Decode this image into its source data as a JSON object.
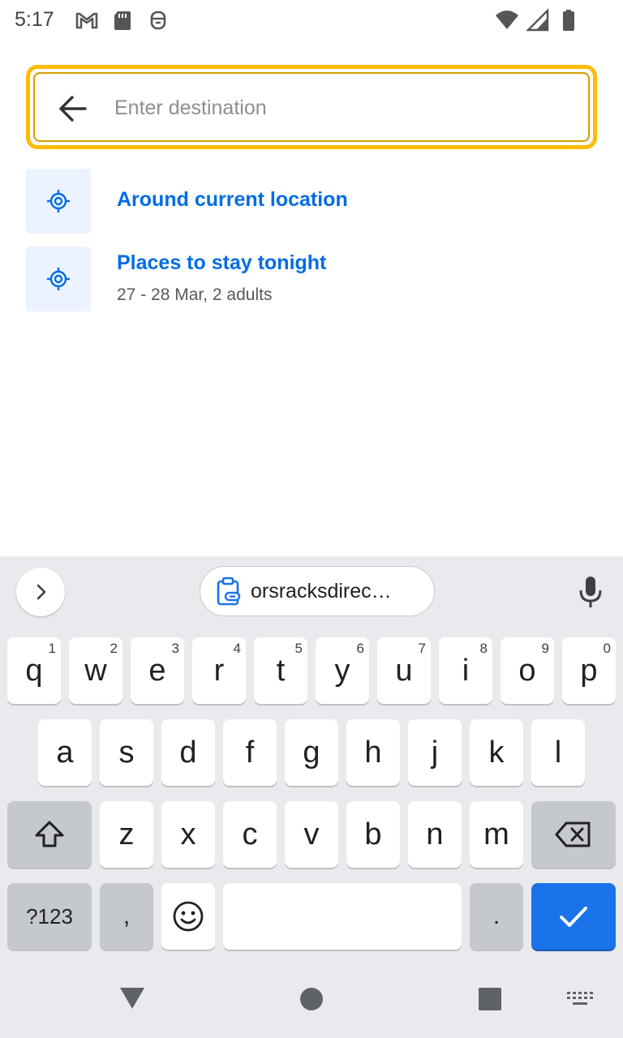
{
  "status_bar": {
    "time": "5:17",
    "left_icons": [
      "gmail-icon",
      "sd-card-icon",
      "accessibility-icon"
    ],
    "right_icons": [
      "wifi-icon",
      "cell-signal-icon",
      "battery-icon"
    ]
  },
  "search": {
    "placeholder": "Enter destination",
    "value": "",
    "border_color": "#febb02"
  },
  "suggestions": [
    {
      "title": "Around current location",
      "subtitle": "",
      "icon": "location-target-icon"
    },
    {
      "title": "Places to stay tonight",
      "subtitle": "27 - 28 Mar, 2 adults",
      "icon": "location-target-icon"
    }
  ],
  "keyboard": {
    "clipboard_chip": "orsracksdirec…",
    "row1": [
      {
        "key": "q",
        "hint": "1"
      },
      {
        "key": "w",
        "hint": "2"
      },
      {
        "key": "e",
        "hint": "3"
      },
      {
        "key": "r",
        "hint": "4"
      },
      {
        "key": "t",
        "hint": "5"
      },
      {
        "key": "y",
        "hint": "6"
      },
      {
        "key": "u",
        "hint": "7"
      },
      {
        "key": "i",
        "hint": "8"
      },
      {
        "key": "o",
        "hint": "9"
      },
      {
        "key": "p",
        "hint": "0"
      }
    ],
    "row2": [
      "a",
      "s",
      "d",
      "f",
      "g",
      "h",
      "j",
      "k",
      "l"
    ],
    "row3": [
      "z",
      "x",
      "c",
      "v",
      "b",
      "n",
      "m"
    ],
    "symbols_label": "?123",
    "comma_label": ",",
    "period_label": "."
  },
  "colors": {
    "link_blue": "#006ce4",
    "icon_bg": "#ebf3ff",
    "enter_key": "#1a73e8"
  }
}
